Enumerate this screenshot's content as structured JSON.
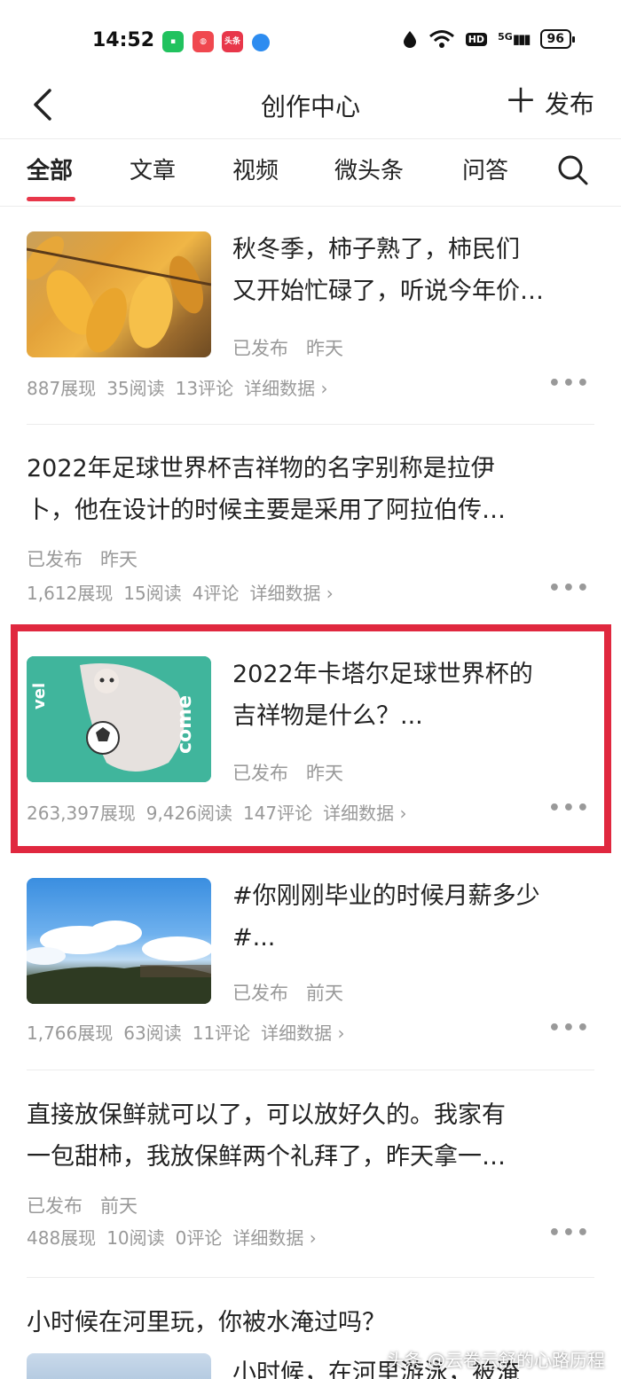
{
  "status_bar": {
    "time": "14:52",
    "apps": [
      {
        "icon": "chat-app-icon",
        "color": "#21c25e",
        "label": ""
      },
      {
        "icon": "gallery-app-icon",
        "color": "#f0484f",
        "label": ""
      },
      {
        "icon": "toutiao-app-icon",
        "color": "#e8374a",
        "label": "头条"
      },
      {
        "icon": "circle-app-icon",
        "color": "#2d8cf0",
        "label": ""
      }
    ],
    "hd": "HD",
    "network": "5G",
    "battery": "96"
  },
  "header": {
    "title": "创作中心",
    "publish_label": "发布",
    "publish_plus": "＋"
  },
  "tabs": [
    {
      "label": "全部",
      "active": true
    },
    {
      "label": "文章",
      "active": false
    },
    {
      "label": "视频",
      "active": false
    },
    {
      "label": "微头条",
      "active": false
    },
    {
      "label": "问答",
      "active": false
    }
  ],
  "accent_color": "#e8374a",
  "highlight_color": "#e0283f",
  "items": [
    {
      "title": "秋冬季，柿子熟了，柿民们又开始忙碌了，听说今年价…",
      "title_line1": "秋冬季，柿子熟了，柿民们",
      "title_line2": "又开始忙碌了，听说今年价…",
      "status": "已发布",
      "time": "昨天",
      "impressions": "887展现",
      "reads": "35阅读",
      "comments": "13评论",
      "details": "详细数据 ›",
      "thumbnail": "persimmon-tree-image"
    },
    {
      "title_line1": "2022年足球世界杯吉祥物的名字别称是拉伊",
      "title_line2": "卜，他在设计的时候主要是采用了阿拉伯传…",
      "status": "已发布",
      "time": "昨天",
      "impressions": "1,612展现",
      "reads": "15阅读",
      "comments": "4评论",
      "details": "详细数据 ›"
    },
    {
      "title_line1": "2022年卡塔尔足球世界杯的",
      "title_line2": "吉祥物是什么？...",
      "status": "已发布",
      "time": "昨天",
      "impressions": "263,397展现",
      "reads": "9,426阅读",
      "comments": "147评论",
      "details": "详细数据 ›",
      "thumbnail": "world-cup-mascot-image"
    },
    {
      "title_line1": "#你刚刚毕业的时候月薪多少",
      "title_line2": "#...",
      "status": "已发布",
      "time": "前天",
      "impressions": "1,766展现",
      "reads": "63阅读",
      "comments": "11评论",
      "details": "详细数据 ›",
      "thumbnail": "blue-sky-clouds-image"
    },
    {
      "title_line1": "直接放保鲜就可以了，可以放好久的。我家有",
      "title_line2": "一包甜柿，我放保鲜两个礼拜了，昨天拿一…",
      "status": "已发布",
      "time": "前天",
      "impressions": "488展现",
      "reads": "10阅读",
      "comments": "0评论",
      "details": "详细数据 ›"
    },
    {
      "title_line1": "小时候在河里玩，你被水淹过吗？",
      "snippet": "小时候，在河里游泳，被淹"
    }
  ],
  "more_label": "•••",
  "watermark": "头条 @云卷云舒的心路历程"
}
